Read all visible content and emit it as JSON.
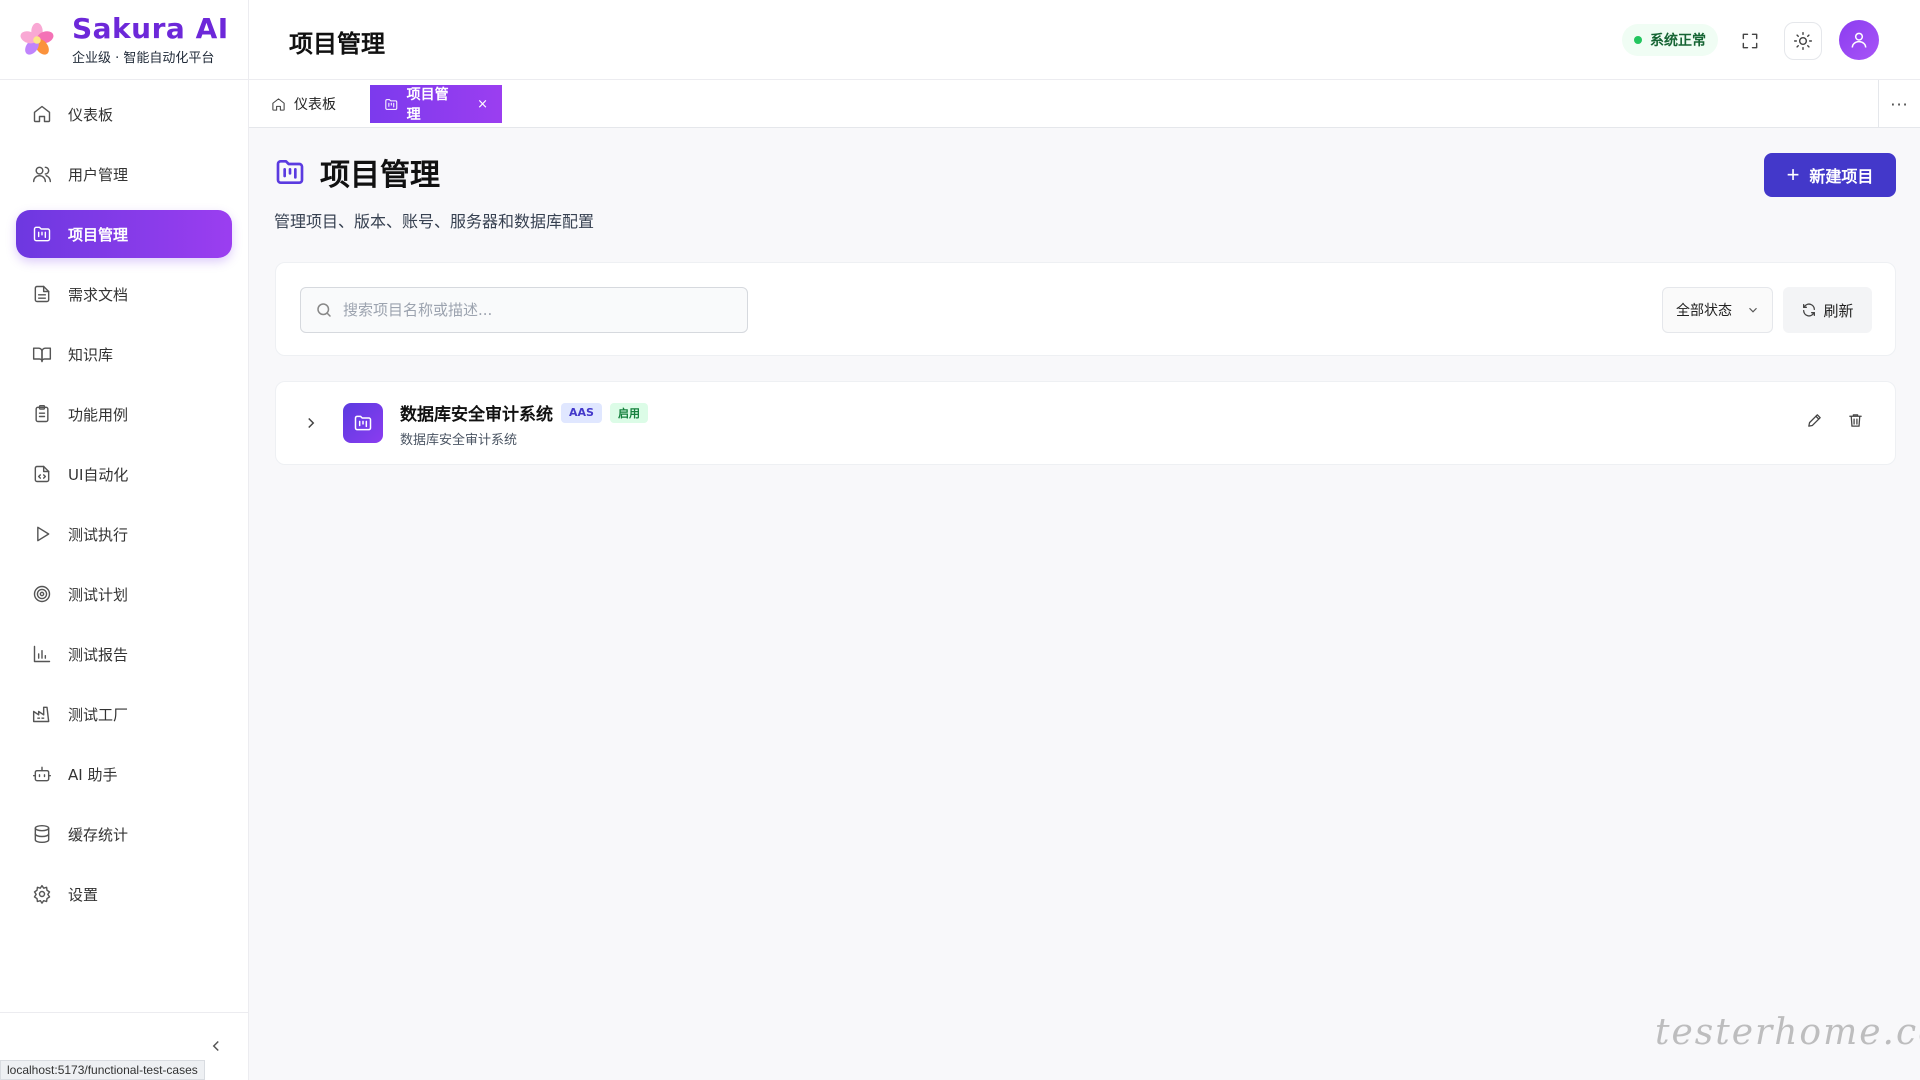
{
  "brand": {
    "title": "Sakura AI",
    "subtitle": "企业级 · 智能自动化平台"
  },
  "sidebar": {
    "items": [
      {
        "label": "仪表板",
        "icon": "home-icon",
        "active": false
      },
      {
        "label": "用户管理",
        "icon": "users-icon",
        "active": false
      },
      {
        "label": "项目管理",
        "icon": "folder-kanban-icon",
        "active": true
      },
      {
        "label": "需求文档",
        "icon": "file-text-icon",
        "active": false
      },
      {
        "label": "知识库",
        "icon": "book-open-icon",
        "active": false
      },
      {
        "label": "功能用例",
        "icon": "clipboard-list-icon",
        "active": false
      },
      {
        "label": "UI自动化",
        "icon": "file-code-icon",
        "active": false
      },
      {
        "label": "测试执行",
        "icon": "play-icon",
        "active": false
      },
      {
        "label": "测试计划",
        "icon": "target-icon",
        "active": false
      },
      {
        "label": "测试报告",
        "icon": "bar-chart-icon",
        "active": false
      },
      {
        "label": "测试工厂",
        "icon": "factory-icon",
        "active": false
      },
      {
        "label": "AI 助手",
        "icon": "bot-icon",
        "active": false
      },
      {
        "label": "缓存统计",
        "icon": "database-icon",
        "active": false
      },
      {
        "label": "设置",
        "icon": "settings-icon",
        "active": false
      }
    ],
    "collapse_icon": "chevron-left-icon"
  },
  "statusbar": {
    "url": "localhost:5173/functional-test-cases"
  },
  "header": {
    "title": "项目管理",
    "system_status": "系统正常",
    "system_status_color": "#22c55e"
  },
  "tabs": {
    "items": [
      {
        "label": "仪表板",
        "icon": "home-icon"
      },
      {
        "label": "项目管理",
        "icon": "folder-kanban-icon",
        "close": "×"
      }
    ],
    "more": "···"
  },
  "page": {
    "title": "项目管理",
    "subtitle": "管理项目、版本、账号、服务器和数据库配置",
    "new_button": "新建项目",
    "new_button_plus": "+",
    "accent_color": "#4338ca"
  },
  "filters": {
    "search_placeholder": "搜索项目名称或描述...",
    "status_select": "全部状态",
    "refresh": "刷新"
  },
  "projects": [
    {
      "name": "数据库安全审计系统",
      "code": "AAS",
      "status": "启用",
      "description": "数据库安全审计系统"
    }
  ],
  "watermark": "testerhome.com"
}
